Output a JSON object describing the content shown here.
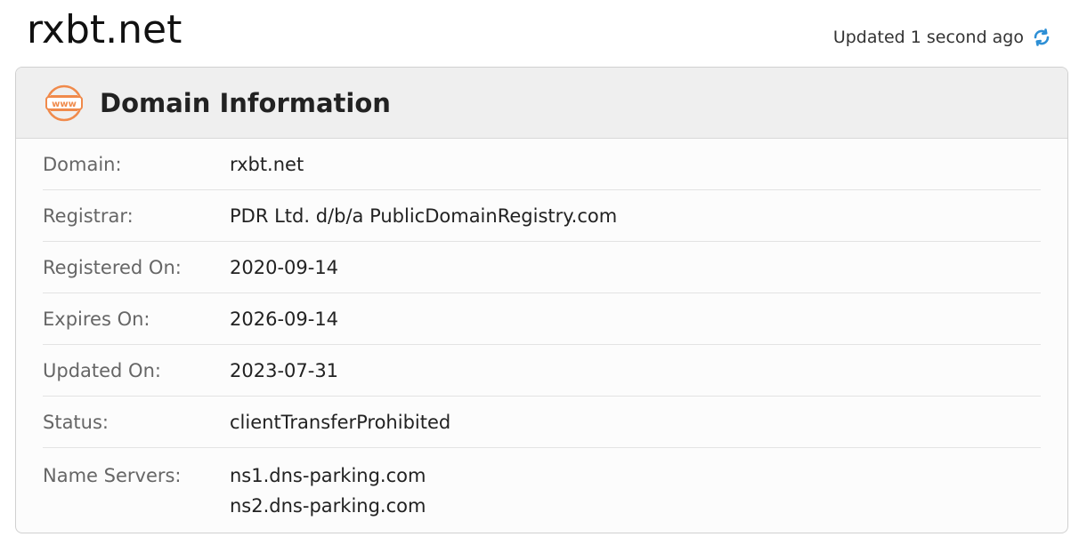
{
  "page": {
    "domain_title": "rxbt.net",
    "updated_text": "Updated 1 second ago"
  },
  "card": {
    "title": "Domain Information",
    "icon": "www-icon"
  },
  "rows": [
    {
      "label": "Domain:",
      "value": "rxbt.net"
    },
    {
      "label": "Registrar:",
      "value": "PDR Ltd. d/b/a PublicDomainRegistry.com"
    },
    {
      "label": "Registered On:",
      "value": "2020-09-14"
    },
    {
      "label": "Expires On:",
      "value": "2026-09-14"
    },
    {
      "label": "Updated On:",
      "value": "2023-07-31"
    },
    {
      "label": "Status:",
      "value": "clientTransferProhibited"
    }
  ],
  "name_servers": {
    "label": "Name Servers:",
    "values": [
      "ns1.dns-parking.com",
      "ns2.dns-parking.com"
    ]
  },
  "colors": {
    "accent_orange": "#f08a4b",
    "refresh_blue": "#2d8fd5"
  }
}
